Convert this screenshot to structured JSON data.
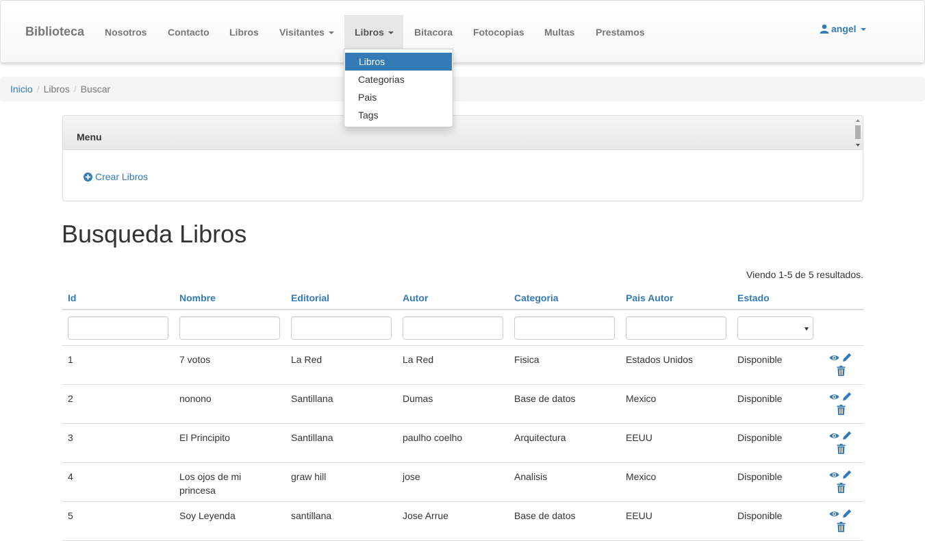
{
  "navbar": {
    "brand": "Biblioteca",
    "items": [
      {
        "label": "Nosotros"
      },
      {
        "label": "Contacto"
      },
      {
        "label": "Libros"
      },
      {
        "label": "Visitantes"
      },
      {
        "label": "Libros"
      },
      {
        "label": "Bitacora"
      },
      {
        "label": "Fotocopias"
      },
      {
        "label": "Multas"
      },
      {
        "label": "Prestamos"
      }
    ],
    "user": "angel",
    "user_icon": "user-icon"
  },
  "dropdown": {
    "items": [
      {
        "label": "Libros",
        "active": true
      },
      {
        "label": "Categorias"
      },
      {
        "label": "Pais"
      },
      {
        "label": "Tags"
      }
    ]
  },
  "breadcrumb": {
    "items": [
      "Inicio",
      "Libros",
      "Buscar"
    ]
  },
  "menu_panel": {
    "title": "Menu",
    "create_label": "Crear Libros",
    "create_icon": "plus-circle-icon"
  },
  "page": {
    "title": "Busqueda Libros",
    "summary": "Viendo 1-5 de 5 resultados."
  },
  "table": {
    "columns": [
      "Id",
      "Nombre",
      "Editorial",
      "Autor",
      "Categoria",
      "Pais Autor",
      "Estado"
    ],
    "rows": [
      [
        "1",
        "7 votos",
        "La Red",
        "La Red",
        "Fisica",
        "Estados Unidos",
        "Disponible"
      ],
      [
        "2",
        "nonono",
        "Santillana",
        "Dumas",
        "Base de datos",
        "Mexico",
        "Disponible"
      ],
      [
        "3",
        "El Principito",
        "Santillana",
        "paulho coelho",
        "Arquitectura",
        "EEUU",
        "Disponible"
      ],
      [
        "4",
        "Los ojos de mi princesa",
        "graw hill",
        "jose",
        "Analisis",
        "Mexico",
        "Disponible"
      ],
      [
        "5",
        "Soy Leyenda",
        "santillana",
        "Jose Arrue",
        "Base de datos",
        "EEUU",
        "Disponible"
      ]
    ],
    "row_actions": [
      "eye-icon",
      "pencil-icon",
      "trash-icon"
    ]
  },
  "colors": {
    "link": "#337ab7",
    "nav_text": "#777777",
    "active_nav_bg": "#e7e7e7",
    "breadcrumb_bg": "#f5f5f5"
  }
}
